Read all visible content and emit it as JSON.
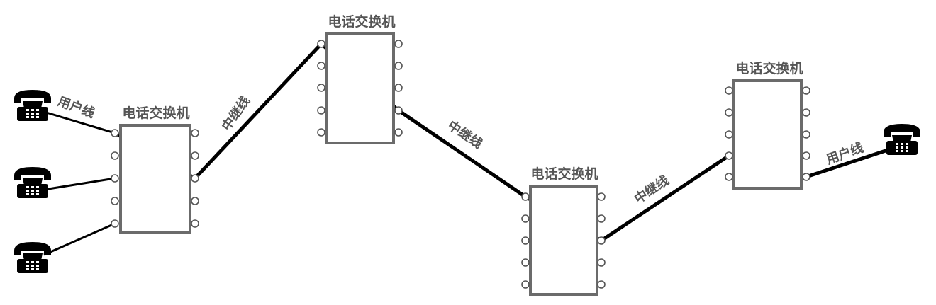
{
  "switches": [
    {
      "id": "sw1",
      "title": "电话交换机"
    },
    {
      "id": "sw2",
      "title": "电话交换机"
    },
    {
      "id": "sw3",
      "title": "电话交换机"
    },
    {
      "id": "sw4",
      "title": "电话交换机"
    }
  ],
  "line_labels": {
    "user_line_left": "用户线",
    "trunk_1": "中继线",
    "trunk_2": "中继线",
    "trunk_3": "中继线",
    "user_line_right": "用户线"
  },
  "phones": [
    {
      "id": "phone-left-1",
      "icon": "telephone-icon"
    },
    {
      "id": "phone-left-2",
      "icon": "telephone-icon"
    },
    {
      "id": "phone-left-3",
      "icon": "telephone-icon"
    },
    {
      "id": "phone-right",
      "icon": "telephone-icon"
    }
  ],
  "colors": {
    "line": "#000000",
    "box_border": "#6b6b6b",
    "label": "#555555"
  }
}
